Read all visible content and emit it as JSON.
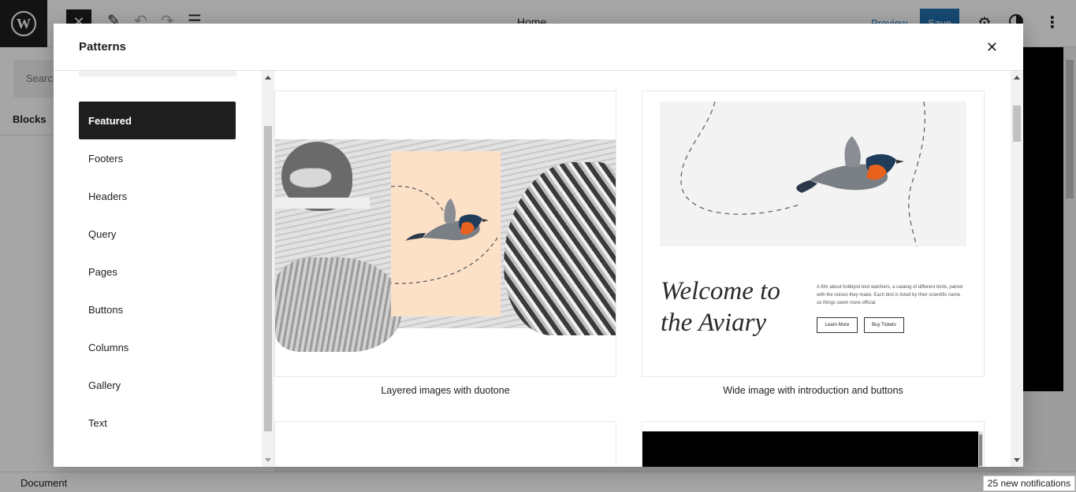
{
  "editor": {
    "logo_letter": "W",
    "home_label": "Home",
    "preview_label": "Preview",
    "save_label": "Save",
    "inserter_search_placeholder": "Search",
    "inserter_tab_blocks": "Blocks",
    "footer_document": "Document"
  },
  "modal": {
    "title": "Patterns",
    "close_glyph": "✕",
    "categories": [
      {
        "label": "Featured",
        "active": true
      },
      {
        "label": "Footers"
      },
      {
        "label": "Headers"
      },
      {
        "label": "Query"
      },
      {
        "label": "Pages"
      },
      {
        "label": "Buttons"
      },
      {
        "label": "Columns"
      },
      {
        "label": "Gallery"
      },
      {
        "label": "Text"
      }
    ],
    "patterns": [
      {
        "label": "Layered images with duotone"
      },
      {
        "label": "Wide image with introduction and buttons",
        "heading": "Welcome to the Aviary",
        "heading_line1": "Welcome to",
        "heading_line2": "the Aviary",
        "description": "A film about hobbyist bird watchers, a catalog of different birds, paired with the noises they make. Each bird is listed by their scientific name so things seem more official.",
        "button_learn": "Learn More",
        "button_tickets": "Buy Tickets"
      }
    ]
  },
  "notifications": {
    "toast": "25 new notifications"
  },
  "colors": {
    "dark": "#1e1e1e",
    "accent": "#2271b1",
    "peach": "#fde1c7",
    "robin_orange": "#e8621e",
    "robin_blue": "#1f3c5a"
  }
}
